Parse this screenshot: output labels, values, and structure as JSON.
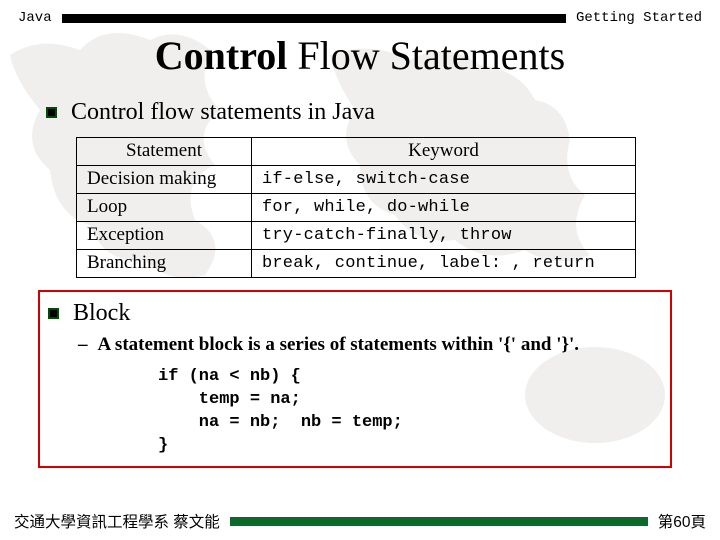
{
  "header": {
    "left": "Java",
    "right": "Getting Started"
  },
  "title": {
    "strong": "Control",
    "rest": " Flow Statements"
  },
  "bullet1": "Control flow statements in Java",
  "table": {
    "h1": "Statement",
    "h2": "Keyword",
    "r1c1": "Decision making",
    "r1c2": "if-else, switch-case",
    "r2c1": "Loop",
    "r2c2": "for, while, do-while",
    "r3c1": "Exception",
    "r3c2": "try-catch-finally, throw",
    "r4c1": "Branching",
    "r4c2": "break, continue, label: , return"
  },
  "bullet2": "Block",
  "sub": "A statement block is a series of statements within '{' and '}'.",
  "code": "if (na < nb) {\n    temp = na;\n    na = nb;  nb = temp;\n}",
  "footer": {
    "left": "交通大學資訊工程學系 蔡文能",
    "right": "第60頁"
  }
}
